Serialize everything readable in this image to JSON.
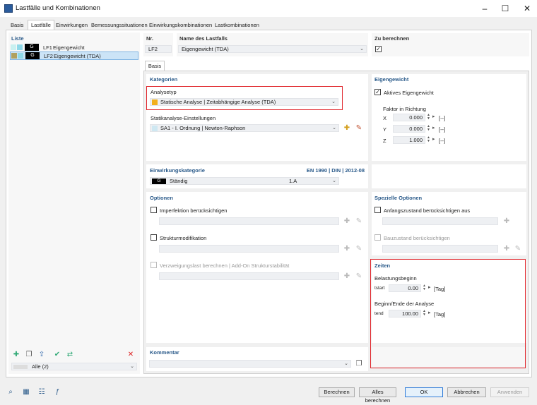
{
  "window": {
    "title": "Lastfälle und Kombinationen"
  },
  "tabs": [
    "Basis",
    "Lastfälle",
    "Einwirkungen",
    "Bemessungssituationen",
    "Einwirkungskombinationen",
    "Lastkombinationen"
  ],
  "list": {
    "header": "Liste",
    "items": [
      {
        "badge": "G",
        "id": "LF1",
        "name": "Eigengewicht"
      },
      {
        "badge": "G",
        "id": "LF2",
        "name": "Eigengewicht (TDA)"
      }
    ],
    "filter": "Alle (2)"
  },
  "top": {
    "nr_label": "Nr.",
    "nr_value": "LF2",
    "name_label": "Name des Lastfalls",
    "name_value": "Eigengewicht (TDA)",
    "calc_label": "Zu berechnen",
    "calc_checked": "✓"
  },
  "subtab": "Basis",
  "kategorien": {
    "header": "Kategorien",
    "analysetyp_label": "Analysetyp",
    "analysetyp_value": "Statische Analyse | Zeitabhängige Analyse (TDA)",
    "statik_label": "Statikanalyse-Einstellungen",
    "statik_value": "SA1 - I. Ordnung | Newton-Raphson"
  },
  "eigengewicht": {
    "header": "Eigengewicht",
    "aktiv_label": "Aktives Eigengewicht",
    "aktiv_checked": "✓",
    "faktor_label": "Faktor in Richtung",
    "rows": [
      {
        "axis": "X",
        "value": "0.000",
        "unit": "[--]"
      },
      {
        "axis": "Y",
        "value": "0.000",
        "unit": "[--]"
      },
      {
        "axis": "Z",
        "value": "1.000",
        "unit": "[--]"
      }
    ]
  },
  "einwirkung": {
    "header": "Einwirkungskategorie",
    "norm": "EN 1990 | DIN | 2012-08",
    "badge": "G",
    "name": "Ständig",
    "code": "1.A"
  },
  "optionen": {
    "header": "Optionen",
    "imperfektion": "Imperfektion berücksichtigen",
    "struktur": "Strukturmodifikation",
    "verzweigung": "Verzweigungslast berechnen | Add-On Strukturstabilität"
  },
  "spezielle": {
    "header": "Spezielle Optionen",
    "anfang": "Anfangszustand berücksichtigen aus",
    "bauzustand": "Bauzustand berücksichtigen"
  },
  "zeiten": {
    "header": "Zeiten",
    "beginn_label": "Belastungsbeginn",
    "tstart_label": "tstart",
    "tstart_value": "0.00",
    "tstart_unit": "[Tag]",
    "ende_label": "Beginn/Ende der Analyse",
    "tend_label": "tend",
    "tend_value": "100.00",
    "tend_unit": "[Tag]"
  },
  "kommentar": {
    "header": "Kommentar"
  },
  "buttons": {
    "berechnen": "Berechnen",
    "alle": "Alles berechnen",
    "ok": "OK",
    "abbrechen": "Abbrechen",
    "anwenden": "Anwenden"
  },
  "colors": {
    "accent": "#2a5a8a",
    "highlight": "#e0252b",
    "selection": "#cce4f7",
    "tda_swatch": "#f2b01e"
  }
}
